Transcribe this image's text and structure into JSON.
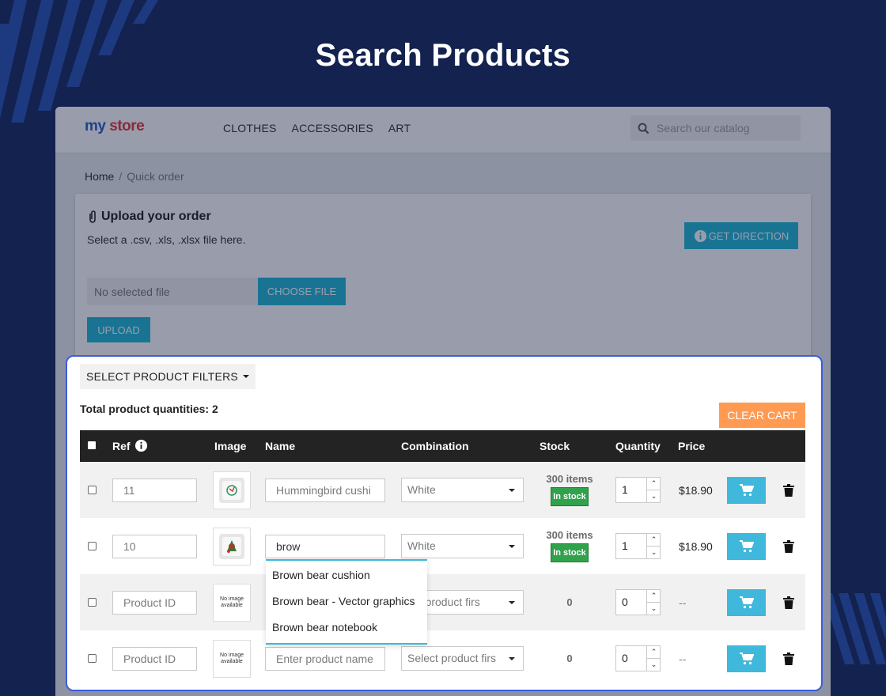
{
  "page_title": "Search Products",
  "store": {
    "logo_part1": "my",
    "logo_part2": "store",
    "nav": [
      "CLOTHES",
      "ACCESSORIES",
      "ART"
    ],
    "search_placeholder": "Search our catalog"
  },
  "breadcrumb": {
    "home": "Home",
    "separator": "/",
    "current": "Quick order"
  },
  "upload": {
    "title": "Upload your order",
    "subtitle": "Select a .csv, .xls, .xlsx file here.",
    "direction_button": "GET DIRECTION",
    "file_placeholder": "No selected file",
    "choose_button": "CHOOSE FILE",
    "upload_button": "UPLOAD"
  },
  "panel": {
    "filters_button": "SELECT PRODUCT FILTERS",
    "total_label": "Total product quantities: 2",
    "clear_cart": "CLEAR CART",
    "columns": {
      "ref": "Ref",
      "image": "Image",
      "name": "Name",
      "combination": "Combination",
      "stock": "Stock",
      "quantity": "Quantity",
      "price": "Price"
    },
    "rows": [
      {
        "ref": "11",
        "image": "hummingbird-cushion",
        "name": "Hummingbird cushi",
        "combination": "White",
        "stock": "300 items",
        "badge": "In stock",
        "qty": "1",
        "price": "$18.90"
      },
      {
        "ref": "10",
        "image": "brown-bear-cushion",
        "name": "brow",
        "combination": "White",
        "stock": "300 items",
        "badge": "In stock",
        "qty": "1",
        "price": "$18.90"
      },
      {
        "ref_placeholder": "Product ID",
        "no_image": "No image available",
        "combination": "ect product firs",
        "stock": "0",
        "qty": "0",
        "price": "--"
      },
      {
        "ref_placeholder": "Product ID",
        "no_image": "No image available",
        "name_placeholder": "Enter product name",
        "combination": "Select product firs",
        "stock": "0",
        "qty": "0",
        "price": "--"
      }
    ],
    "suggestions": [
      "Brown bear cushion",
      "Brown bear - Vector graphics",
      "Brown bear notebook"
    ]
  },
  "colors": {
    "background": "#13224f",
    "accent": "#24b9d7",
    "cart_button": "#3fb8dc",
    "clear_cart": "#ff9a52",
    "in_stock": "#31a24c",
    "panel_border": "#3d5bdb"
  }
}
